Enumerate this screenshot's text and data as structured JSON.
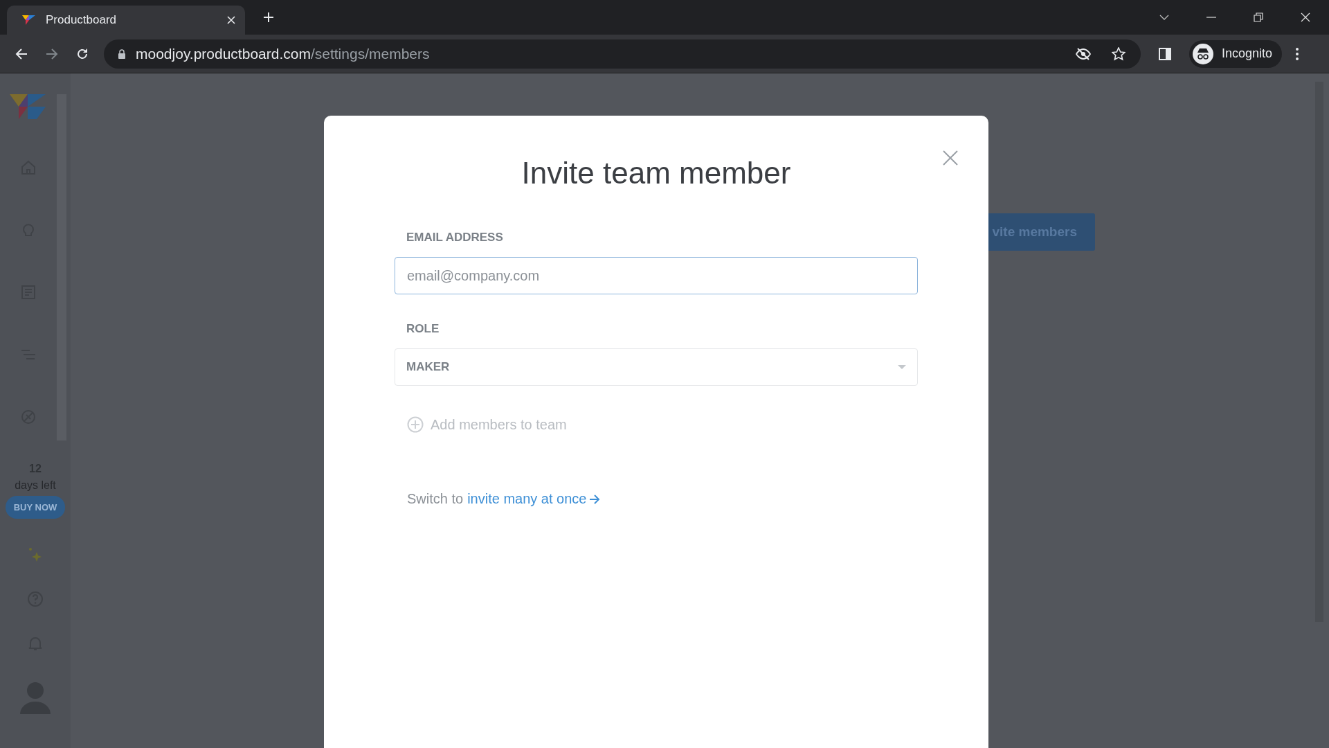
{
  "browser": {
    "tab_title": "Productboard",
    "url_host": "moodjoy.productboard.com",
    "url_path": "/settings/members",
    "profile": "Incognito"
  },
  "sidebar": {
    "trial_days": "12",
    "trial_text": "days left",
    "buy_button": "BUY NOW"
  },
  "background": {
    "button": "vite members"
  },
  "modal": {
    "title": "Invite team member",
    "email": {
      "label": "EMAIL ADDRESS",
      "placeholder": "email@company.com"
    },
    "role": {
      "label": "ROLE",
      "value": "MAKER"
    },
    "add_link": "Add members to team",
    "switch_text": "Switch to",
    "switch_link": "invite many at once"
  }
}
